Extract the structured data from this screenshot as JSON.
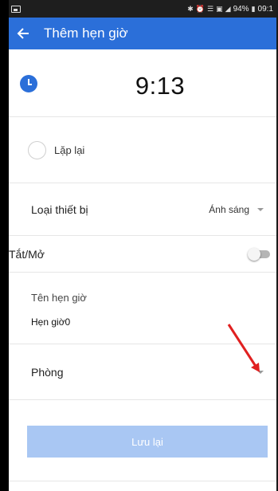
{
  "status_bar": {
    "battery": "94%",
    "time": "09:1",
    "icons": [
      "image-icon",
      "bluetooth-icon",
      "alarm-icon",
      "wifi-icon",
      "nfc-icon",
      "signal-icon",
      "battery-icon"
    ]
  },
  "app_bar": {
    "title": "Thêm hẹn giờ",
    "color": "#2b6fd9"
  },
  "timer": {
    "time": "9:13"
  },
  "repeat": {
    "label": "Lặp lại",
    "checked": false
  },
  "device_type": {
    "label": "Loại thiết bị",
    "value": "Ánh sáng"
  },
  "on_off": {
    "label": "Tắt/Mở",
    "on": false
  },
  "timer_name": {
    "label": "Tên hẹn giờ",
    "value": "Hẹn giờ0"
  },
  "room": {
    "label": "Phòng",
    "value": ""
  },
  "save_button": {
    "label": "Lưu lại",
    "color": "#a9c7f3"
  },
  "annotation": {
    "color": "#e02020"
  }
}
